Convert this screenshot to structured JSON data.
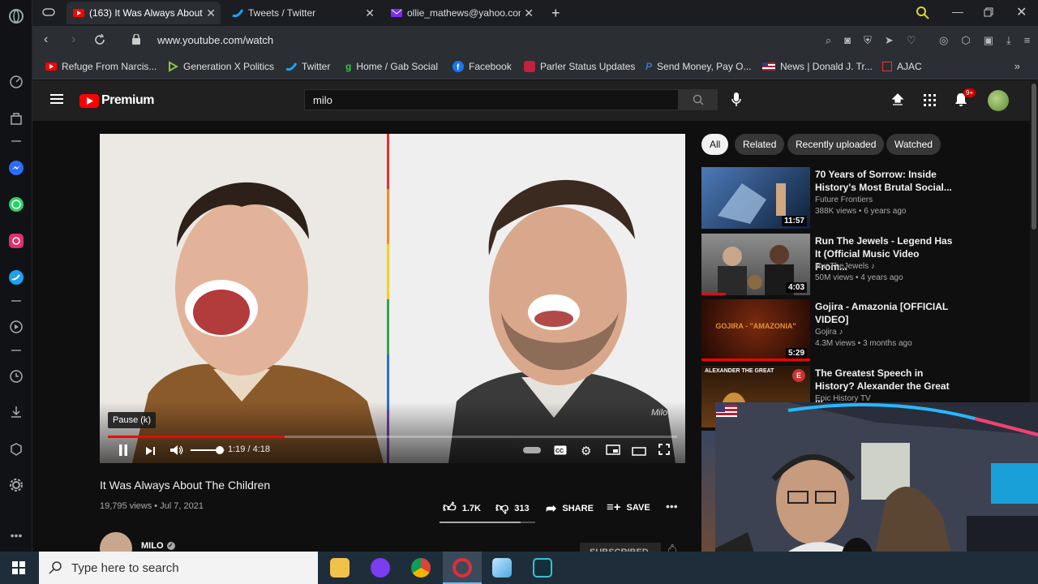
{
  "tabs": [
    {
      "title": "(163) It Was Always About",
      "active": true
    },
    {
      "title": "Tweets / Twitter",
      "active": false
    },
    {
      "title": "ollie_mathews@yahoo.com",
      "active": false
    }
  ],
  "address": {
    "url": "www.youtube.com/watch"
  },
  "bookmarks": [
    "Refuge From Narcis...",
    "Generation X Politics",
    "Twitter",
    "Home / Gab Social",
    "Facebook",
    "Parler Status Updates",
    "Send Money, Pay O...",
    "News | Donald J. Tr...",
    "AJAC"
  ],
  "youtube": {
    "logo_text": "Premium",
    "search_value": "milo",
    "notif_count": "9+",
    "player": {
      "tooltip": "Pause (k)",
      "time": "1:19 / 4:18",
      "progress": 0.31,
      "volume": 0.85,
      "watermark": "Milo"
    },
    "video": {
      "title": "It Was Always About The Children",
      "meta": "19,795 views • Jul 7, 2021",
      "likes": "1.7K",
      "dislikes": "313",
      "share": "SHARE",
      "save": "SAVE",
      "channel": "MILO",
      "subscribed": "SUBSCRIBED"
    },
    "chips": [
      "All",
      "Related",
      "Recently uploaded",
      "Watched"
    ],
    "recs": [
      {
        "title": "70 Years of Sorrow: Inside History's Most Brutal Social...",
        "channel": "Future Frontiers",
        "meta": "388K views • 6 years ago",
        "duration": "11:57"
      },
      {
        "title": "Run The Jewels - Legend Has It (Official Music Video From...",
        "channel": "RunTheJewels ♪",
        "meta": "50M views • 4 years ago",
        "duration": "4:03"
      },
      {
        "title": "Gojira - Amazonia [OFFICIAL VIDEO]",
        "channel": "Gojira ♪",
        "meta": "4.3M views • 3 months ago",
        "duration": "5:29",
        "thumb_text": "GOJIRA - \"AMAZONIA\""
      },
      {
        "title": "The Greatest Speech in History? Alexander the Great ...",
        "channel": "Epic History TV",
        "meta": "",
        "duration": "",
        "thumb_text": "ALEXANDER THE GREAT",
        "badge": "E"
      }
    ]
  },
  "taskbar": {
    "search_placeholder": "Type here to search"
  }
}
